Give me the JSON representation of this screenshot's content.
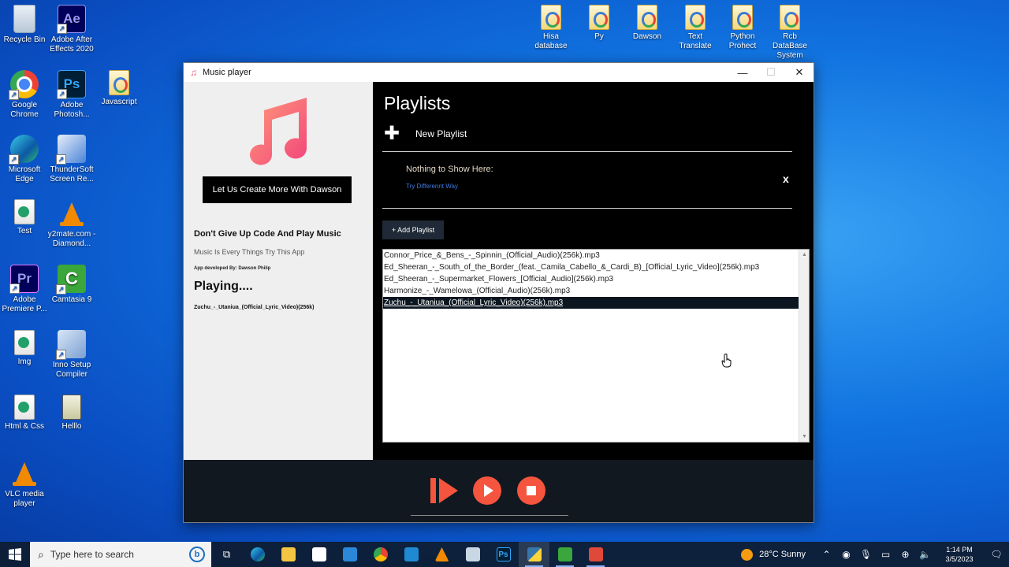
{
  "desktop": {
    "left_icons": [
      {
        "label": "Recycle Bin",
        "icon": "recycle-bin-icon"
      },
      {
        "label": "Adobe After Effects 2020",
        "icon": "after-effects-icon",
        "glyph": "Ae"
      },
      {
        "label": "Google Chrome",
        "icon": "chrome-icon"
      },
      {
        "label": "Adobe Photosh...",
        "icon": "photoshop-icon",
        "glyph": "Ps"
      },
      {
        "label": "Javascript",
        "icon": "folder-icon"
      },
      {
        "label": "Microsoft Edge",
        "icon": "edge-icon"
      },
      {
        "label": "ThunderSoft Screen Re...",
        "icon": "thundersoft-icon"
      },
      {
        "label": "Test",
        "icon": "file-icon"
      },
      {
        "label": "y2mate.com - Diamond...",
        "icon": "vlc-file-icon"
      },
      {
        "label": "Adobe Premiere P...",
        "icon": "premiere-icon",
        "glyph": "Pr"
      },
      {
        "label": "Camtasia 9",
        "icon": "camtasia-icon"
      },
      {
        "label": "Img",
        "icon": "file-icon"
      },
      {
        "label": "Inno Setup Compiler",
        "icon": "inno-setup-icon"
      },
      {
        "label": "Html & Css",
        "icon": "file-icon"
      },
      {
        "label": "Helllo",
        "icon": "book-icon"
      },
      {
        "label": "VLC media player",
        "icon": "vlc-icon"
      }
    ],
    "top_icons": [
      {
        "label": "Hisa database",
        "icon": "folder-icon"
      },
      {
        "label": "Py",
        "icon": "folder-icon"
      },
      {
        "label": "Dawson",
        "icon": "folder-icon"
      },
      {
        "label": "Text Translate",
        "icon": "folder-icon"
      },
      {
        "label": "Python Prohect",
        "icon": "folder-icon"
      },
      {
        "label": "Rcb DataBase System",
        "icon": "folder-icon"
      }
    ]
  },
  "window": {
    "title": "Music player",
    "controls": {
      "minimize": "—",
      "maximize": "☐",
      "close": "✕"
    }
  },
  "left_pane": {
    "button_label": "Let Us Create More With Dawson",
    "heading": "Don't Give Up Code And Play Music",
    "subheading": "Music Is Every Things Try This App",
    "credit": "App devoloped By: Dawson Philip",
    "playing_label": "Playing....",
    "now_playing": "Zuchu_-_Utaniua_(Official_Lyric_Video)(256k)"
  },
  "right_pane": {
    "title": "Playlists",
    "new_playlist_label": "New Playlist",
    "empty_title": "Nothing to Show Here:",
    "empty_subtitle": "Try Differennt Way",
    "close_label": "x",
    "add_playlist_label": "+ Add Playlist",
    "songs": [
      "Connor_Price_&_Bens_-_Spinnin_(Official_Audio)(256k).mp3",
      "Ed_Sheeran_-_South_of_the_Border_(feat._Camila_Cabello_&_Cardi_B)_[Official_Lyric_Video](256k).mp3",
      "Ed_Sheeran_-_Supermarket_Flowers_[Official_Audio](256k).mp3",
      "Harmonize_-_Wamelowa_(Official_Audio)(256k).mp3",
      "Zuchu_-_Utaniua_(Official_Lyric_Video)(256k).mp3"
    ],
    "selected_index": 4
  },
  "player_controls": {
    "accent_color": "#f5543f",
    "buttons": [
      "skip-icon",
      "play-icon",
      "stop-icon"
    ]
  },
  "taskbar": {
    "search_placeholder": "Type here to search",
    "weather": "28°C  Sunny",
    "time": "1:14 PM",
    "date": "3/5/2023"
  }
}
